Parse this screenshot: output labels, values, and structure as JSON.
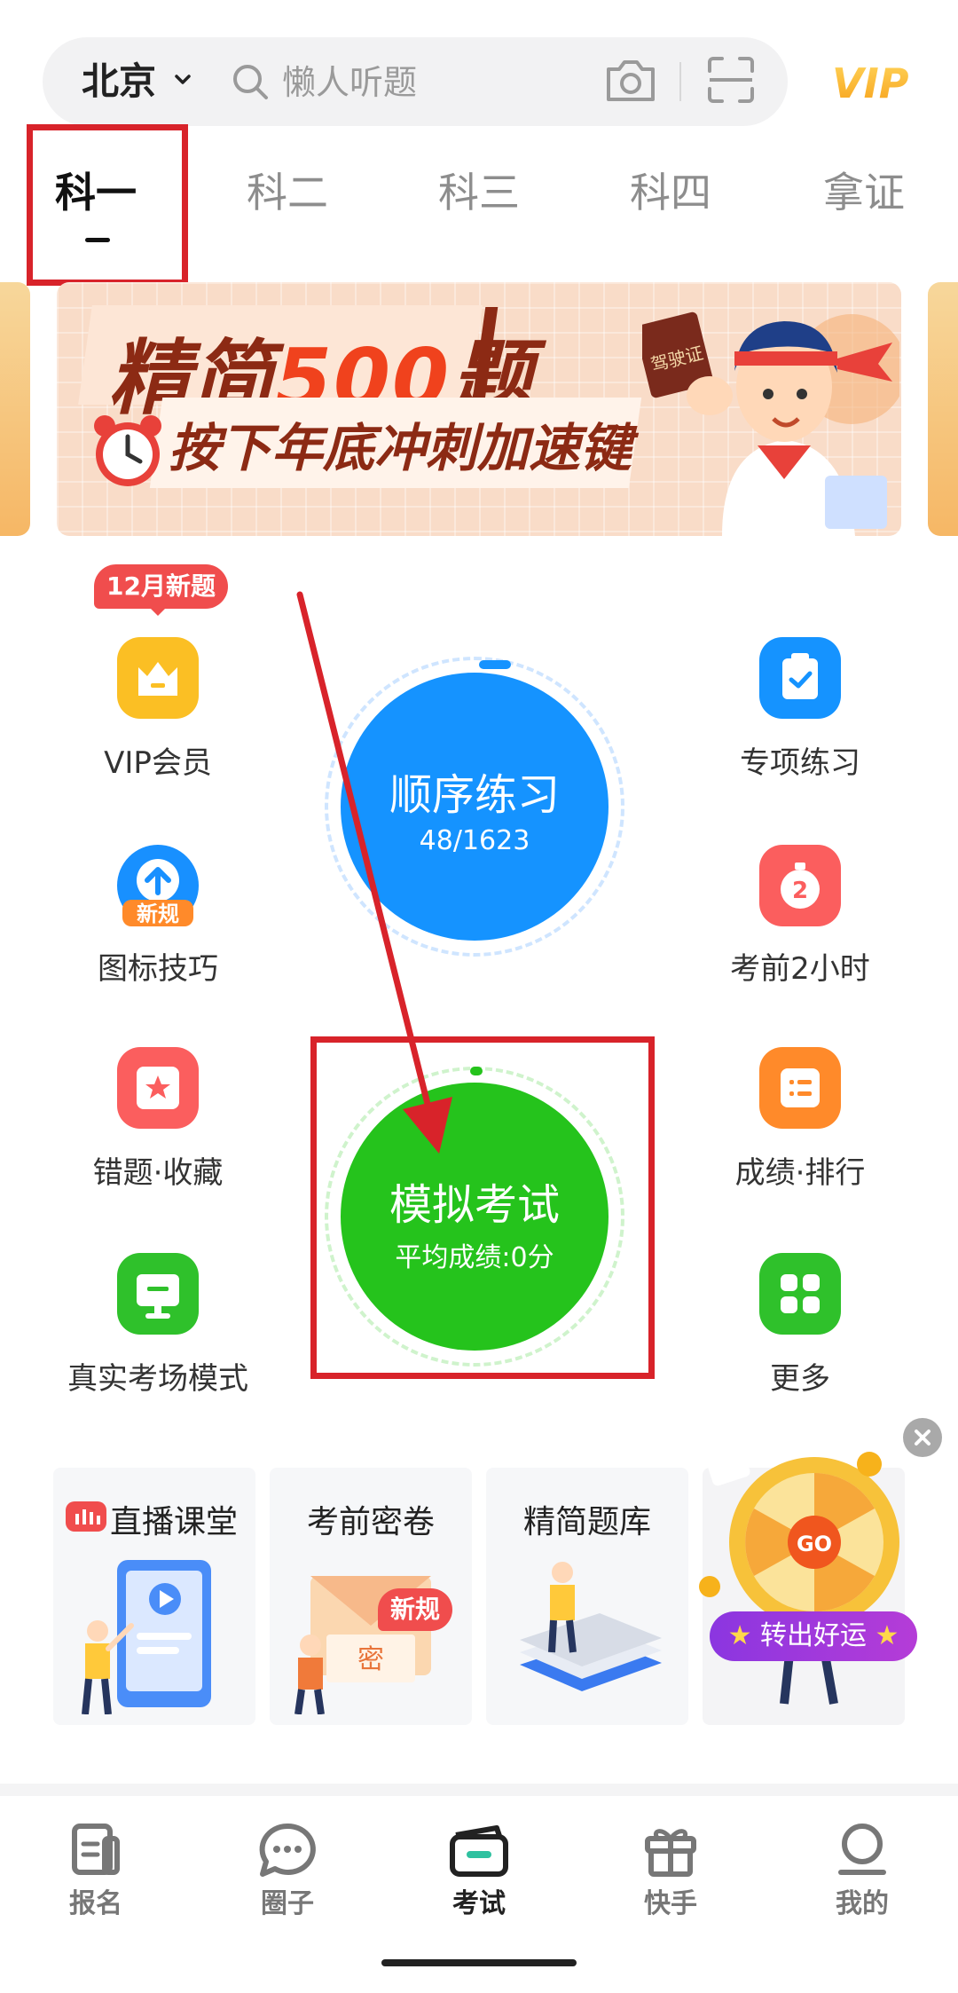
{
  "header": {
    "city": "北京",
    "search_placeholder": "懒人听题",
    "vip_label": "VIP"
  },
  "tabs": [
    {
      "label": "科一",
      "active": true
    },
    {
      "label": "科二",
      "active": false
    },
    {
      "label": "科三",
      "active": false
    },
    {
      "label": "科四",
      "active": false
    },
    {
      "label": "拿证",
      "active": false
    }
  ],
  "banner": {
    "title_prefix": "精简",
    "title_number": "500",
    "title_suffix": "题",
    "subtitle": "按下年底冲刺加速键",
    "book_text": "驾驶证"
  },
  "grid_left": [
    {
      "label": "VIP会员",
      "badge": "12月新题",
      "icon": "crown-icon",
      "color": "#fbbf24"
    },
    {
      "label": "图标技巧",
      "badge_small": "新规",
      "icon": "upload-arrow-icon",
      "color": "#1890ff"
    },
    {
      "label": "错题·收藏",
      "icon": "star-icon",
      "color": "#fb5e5e"
    },
    {
      "label": "真实考场模式",
      "icon": "monitor-icon",
      "color": "#2fc12b"
    }
  ],
  "grid_right": [
    {
      "label": "专项练习",
      "icon": "clipboard-check-icon",
      "color": "#1593ff"
    },
    {
      "label": "考前2小时",
      "icon": "stopwatch-icon",
      "color": "#fb5e5e"
    },
    {
      "label": "成绩·排行",
      "icon": "list-icon",
      "color": "#ff8a2a"
    },
    {
      "label": "更多",
      "icon": "grid-four-icon",
      "color": "#2fc12b"
    }
  ],
  "practice": {
    "title": "顺序练习",
    "progress": "48/1623"
  },
  "exam": {
    "title": "模拟考试",
    "average": "平均成绩:0分"
  },
  "cards": [
    {
      "title": "直播课堂",
      "tag": "live-bars-icon"
    },
    {
      "title": "考前密卷",
      "badge": "新规",
      "stamp": "密"
    },
    {
      "title": "精简题库"
    }
  ],
  "lucky": {
    "label": "转出好运",
    "wheel_text": "GO"
  },
  "bottom_nav": [
    {
      "label": "报名",
      "icon": "document-icon",
      "active": false
    },
    {
      "label": "圈子",
      "icon": "chat-bubble-icon",
      "active": false
    },
    {
      "label": "考试",
      "icon": "wallet-card-icon",
      "active": true
    },
    {
      "label": "快手",
      "icon": "gift-icon",
      "active": false
    },
    {
      "label": "我的",
      "icon": "profile-icon",
      "active": false
    }
  ],
  "colors": {
    "blue": "#1593ff",
    "green": "#25c31c",
    "annotation_red": "#d8232a"
  }
}
